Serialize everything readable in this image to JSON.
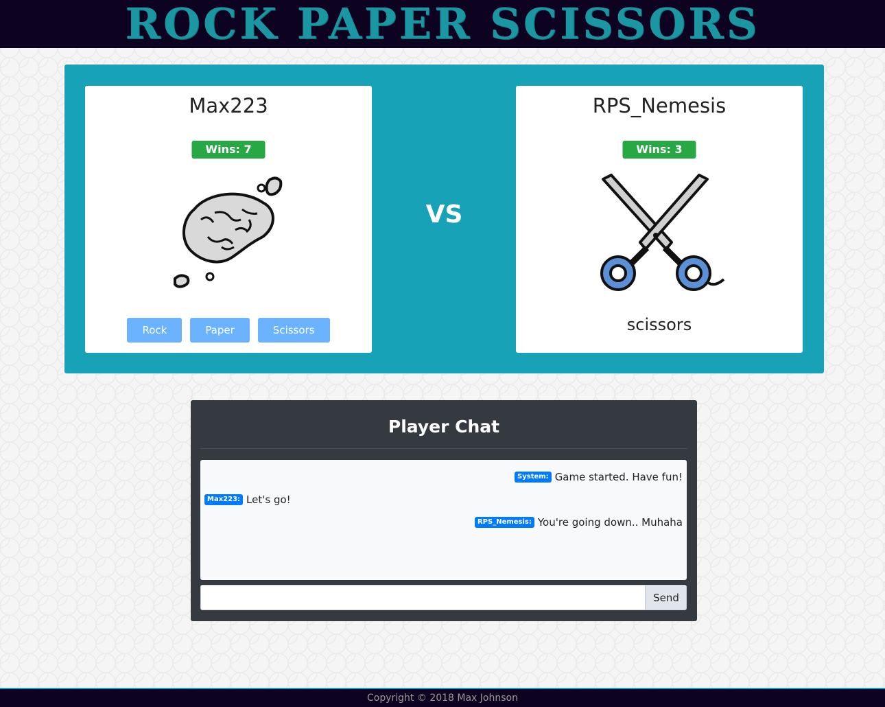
{
  "header": {
    "title": "ROCK PAPER SCISSORS"
  },
  "players": {
    "left": {
      "name": "Max223",
      "wins": "Wins: 7",
      "pick_icon": "rock-icon"
    },
    "right": {
      "name": "RPS_Nemesis",
      "wins": "Wins: 3",
      "pick_icon": "scissors-icon",
      "choice": "scissors"
    }
  },
  "controls": {
    "rock": "Rock",
    "paper": "Paper",
    "scissors": "Scissors"
  },
  "vs_label": "VS",
  "chat": {
    "title": "Player Chat",
    "messages": [
      {
        "sender": "System:",
        "text": "Game started. Have fun!",
        "align": "right"
      },
      {
        "sender": "Max223:",
        "text": "Let's go!",
        "align": "left"
      },
      {
        "sender": "RPS_Nemesis:",
        "text": "You're going down.. Muhaha",
        "align": "right"
      }
    ],
    "input_value": "",
    "send_label": "Send"
  },
  "footer": {
    "copyright": "Copyright © 2018 Max Johnson"
  },
  "colors": {
    "header_bg": "#0d0320",
    "title": "#1b96a3",
    "arena": "#17a2b8",
    "wins_badge": "#28a745",
    "choice_button": "#6bb2ff",
    "chat_bg": "#343a40",
    "sender_tag": "#007bff"
  }
}
